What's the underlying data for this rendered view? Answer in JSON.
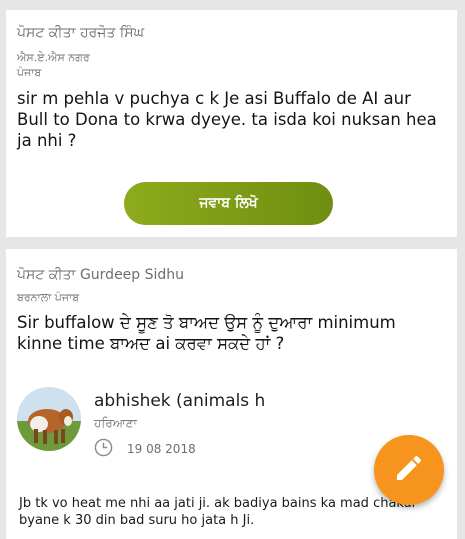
{
  "posts": [
    {
      "posted_by": "ਪੋਸਟ ਕੀਤਾ ਹਰਜੋਤ ਸਿੰਘ",
      "location_line1": "ਐਸ.ਏ.ਐਸ ਨਗਰ",
      "location_line2": "ਪੰਜਾਬ",
      "question": "sir m pehla v puchya c k Je asi Buffalo de AI aur Bull to Dona to krwa dyeye.  ta isda koi nuksan hea ja nhi ?",
      "answer_button": "ਜਵਾਬ ਲਿਖੋ"
    },
    {
      "posted_by": "ਪੋਸਟ ਕੀਤਾ Gurdeep Sidhu",
      "location": "ਬਰਨਾਲਾ ਪੰਜਾਬ",
      "question": "Sir buffalow ਦੇ ਸੂਣ ਤੋ ਬਾਅਦ ਉਸ ਨੂੰ ਦੁਆਰਾ minimum kinne time ਬਾਅਦ ai ਕਰਵਾ ਸਕਦੇ ਹਾਂ ?",
      "answer": {
        "name": "abhishek  (animals h",
        "state": "ਹਰਿਆਣਾ",
        "date": "19 08 2018",
        "text": "Jb tk vo heat me nhi aa jati ji. ak badiya bains ka mad chakar byane k 30 din bad suru ho jata h Ji."
      }
    }
  ],
  "icons": {
    "clock": "clock-icon",
    "fab": "pencil-icon"
  },
  "colors": {
    "button_green": "#7d9c16",
    "fab_orange": "#f7941d"
  }
}
